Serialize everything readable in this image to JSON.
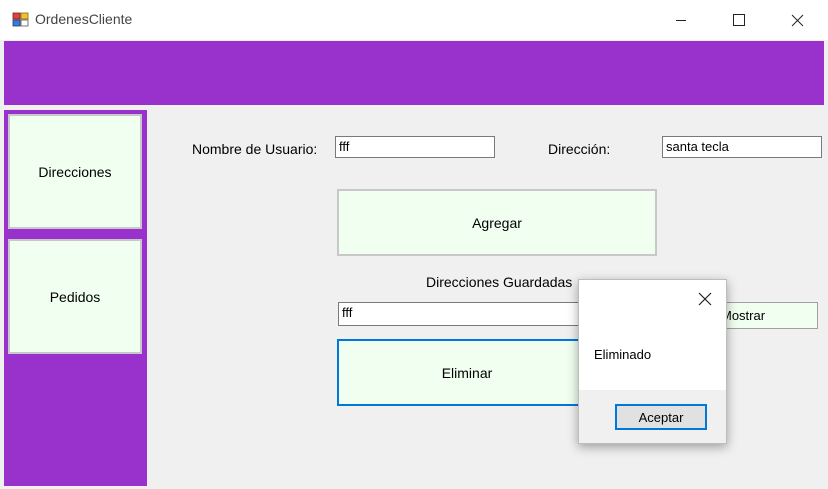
{
  "window": {
    "title": "OrdenesCliente",
    "controls": {
      "minimize": "minimize-icon",
      "maximize": "maximize-icon",
      "close": "close-icon"
    }
  },
  "colors": {
    "accent": "#9932cc",
    "button_bg": "#f0fff0",
    "focus_border": "#0078d7"
  },
  "sidebar": {
    "items": [
      {
        "label": "Direcciones"
      },
      {
        "label": "Pedidos"
      }
    ]
  },
  "form": {
    "username_label": "Nombre de Usuario:",
    "username_value": "fff",
    "address_label": "Dirección:",
    "address_value": "santa tecla",
    "add_button": "Agregar",
    "saved_label": "Direcciones Guardadas",
    "saved_value": "fff",
    "show_button": "Mostrar",
    "delete_button": "Eliminar"
  },
  "dialog": {
    "message": "Eliminado",
    "ok_button": "Aceptar"
  }
}
